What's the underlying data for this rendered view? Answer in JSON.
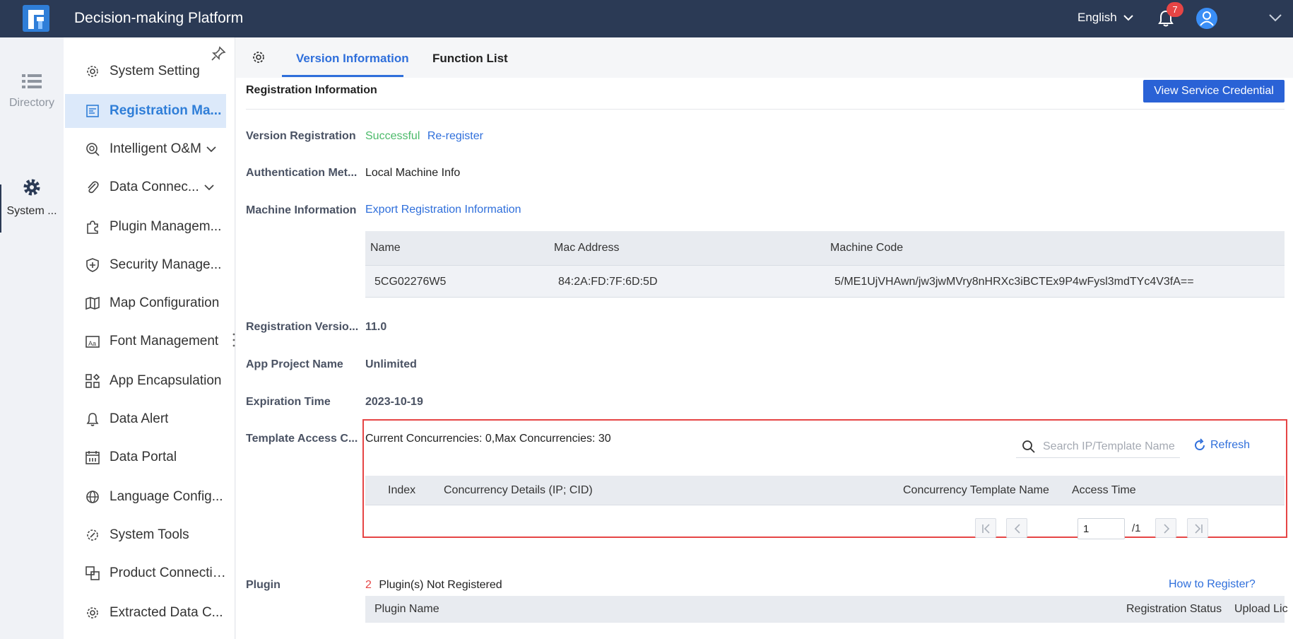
{
  "app": {
    "title": "Decision-making Platform",
    "language": "English",
    "notification_count": "7",
    "brand_color": "#2b3a55",
    "accent_color": "#2f6fdb"
  },
  "rail": {
    "items": [
      {
        "label": "Directory",
        "icon": "list-icon"
      },
      {
        "label": "System ...",
        "icon": "gear-icon"
      }
    ]
  },
  "sidebar": {
    "items": [
      {
        "label": "System Setting",
        "icon": "gear-icon"
      },
      {
        "label": "Registration Ma...",
        "icon": "registration-icon"
      },
      {
        "label": "Intelligent O&M",
        "icon": "om-icon"
      },
      {
        "label": "Data Connec...",
        "icon": "paperclip-icon"
      },
      {
        "label": "Plugin Managem...",
        "icon": "puzzle-icon"
      },
      {
        "label": "Security Manage...",
        "icon": "shield-icon"
      },
      {
        "label": "Map Configuration",
        "icon": "map-icon"
      },
      {
        "label": "Font Management",
        "icon": "font-icon"
      },
      {
        "label": "App Encapsulation",
        "icon": "app-grid-icon"
      },
      {
        "label": "Data Alert",
        "icon": "bell-icon"
      },
      {
        "label": "Data Portal",
        "icon": "calendar-icon"
      },
      {
        "label": "Language Config...",
        "icon": "globe-icon"
      },
      {
        "label": "System Tools",
        "icon": "tools-gear-icon"
      },
      {
        "label": "Product Connection",
        "icon": "link-squares-icon"
      },
      {
        "label": "Extracted Data C...",
        "icon": "gear-icon"
      }
    ]
  },
  "tabs": [
    {
      "label": "Version Information"
    },
    {
      "label": "Function List"
    }
  ],
  "registration": {
    "section_title": "Registration Information",
    "view_credential_button": "View Service Credential",
    "version_registration": {
      "label": "Version Registration",
      "status": "Successful",
      "action": "Re-register"
    },
    "auth_method": {
      "label": "Authentication Met...",
      "value": "Local Machine Info"
    },
    "machine_info": {
      "label": "Machine Information",
      "action": "Export Registration Information"
    },
    "machine_table": {
      "headers": [
        "Name",
        "Mac Address",
        "Machine Code"
      ],
      "row": [
        "5CG02276W5",
        "84:2A:FD:7F:6D:5D",
        "5/ME1UjVHAwn/jw3jwMVry8nHRXc3iBCTEx9P4wFysl3mdTYc4V3fA=="
      ]
    },
    "registration_version": {
      "label": "Registration Versio...",
      "value": "11.0"
    },
    "app_project_name": {
      "label": "App Project Name",
      "value": "Unlimited"
    },
    "expiration_time": {
      "label": "Expiration Time",
      "value": "2023-10-19"
    }
  },
  "concurrency": {
    "label": "Template Access C...",
    "summary": "Current Concurrencies: 0,Max Concurrencies: 30",
    "search_placeholder": "Search IP/Template Name",
    "refresh_label": "Refresh",
    "headers": [
      "Index",
      "Concurrency Details (IP; CID)",
      "Concurrency Template Name",
      "Access Time"
    ],
    "pager": {
      "current_page": "1",
      "total": "/1"
    }
  },
  "plugin": {
    "label": "Plugin",
    "count": "2",
    "status_text": "Plugin(s) Not Registered",
    "help_link": "How to Register?",
    "headers": [
      "Plugin Name",
      "Registration Status",
      "Upload Lic"
    ]
  }
}
